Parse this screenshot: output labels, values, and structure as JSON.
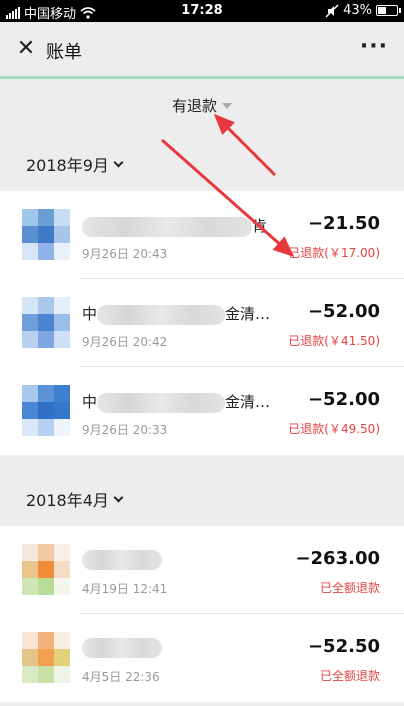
{
  "status_bar": {
    "carrier": "中国移动",
    "time": "17:28",
    "battery": "43%",
    "icons": [
      "signal-icon",
      "wifi-icon",
      "mute-icon",
      "battery-icon"
    ]
  },
  "header": {
    "close_icon": "close-icon",
    "close_glyph": "✕",
    "title": "账单",
    "more_icon": "more-icon",
    "more_glyph": "···"
  },
  "filter": {
    "label": "有退款"
  },
  "sections": [
    {
      "month": "2018年9月",
      "rows": [
        {
          "name_suffix": "肯",
          "date": "9月26日 20:43",
          "amount": "−21.50",
          "refund": "已退款(￥17.00)"
        },
        {
          "name_prefix": "中",
          "name_suffix": "金清…",
          "date": "9月26日 20:42",
          "amount": "−52.00",
          "refund": "已退款(￥41.50)"
        },
        {
          "name_prefix": "中",
          "name_suffix": "金清…",
          "date": "9月26日 20:33",
          "amount": "−52.00",
          "refund": "已退款(￥49.50)"
        }
      ]
    },
    {
      "month": "2018年4月",
      "rows": [
        {
          "name_suffix": "",
          "date": "4月19日 12:41",
          "amount": "−263.00",
          "refund": "已全额退款"
        },
        {
          "name_suffix": "",
          "date": "4月5日 22:36",
          "amount": "−52.50",
          "refund": "已全额退款"
        }
      ]
    }
  ],
  "colors": {
    "accent_line": "#a6dbbd",
    "refund_red": "#e64340",
    "annotation_arrow": "#e8383d"
  }
}
